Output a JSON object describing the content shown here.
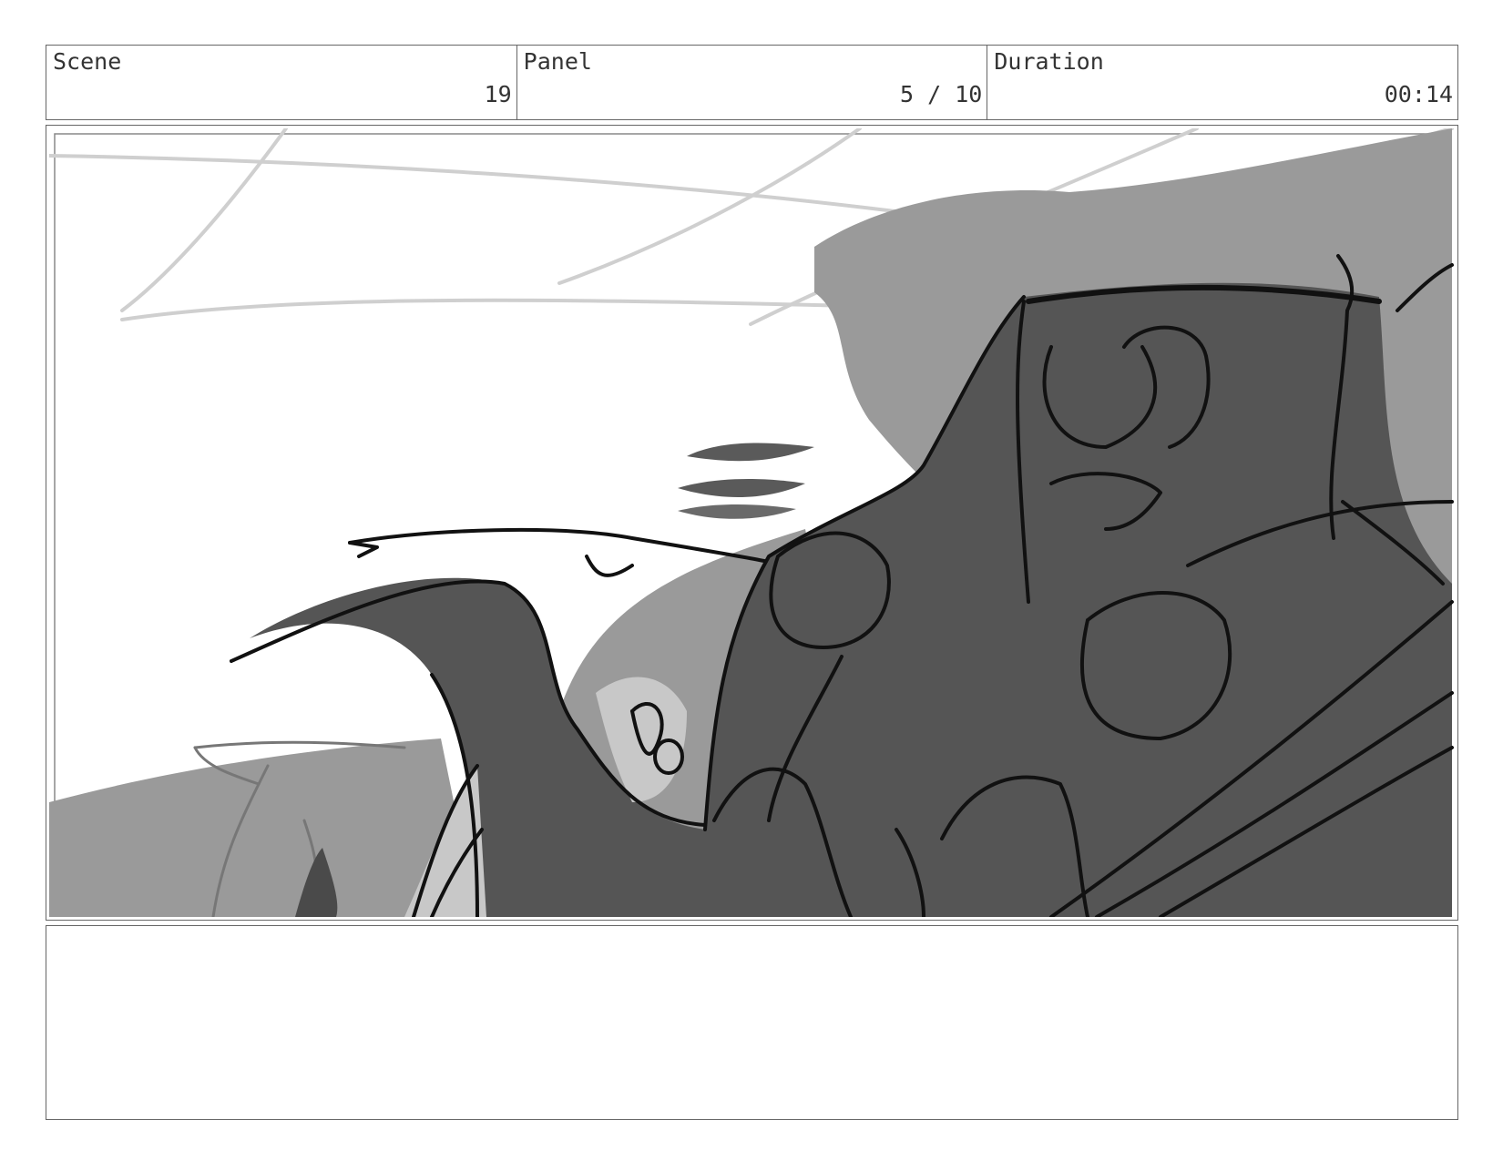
{
  "header": {
    "scene": {
      "label": "Scene",
      "value": "19"
    },
    "panel": {
      "label": "Panel",
      "value": "5 / 10"
    },
    "duration": {
      "label": "Duration",
      "value": "00:14"
    }
  },
  "artwork": {
    "description_icon": "storyboard-sketch-image"
  },
  "notes": {
    "text": ""
  },
  "colors": {
    "border": "#666666",
    "text": "#333333",
    "dark_fill": "#555555",
    "mid_fill": "#9a9a9a",
    "light_fill": "#c8c8c8"
  }
}
